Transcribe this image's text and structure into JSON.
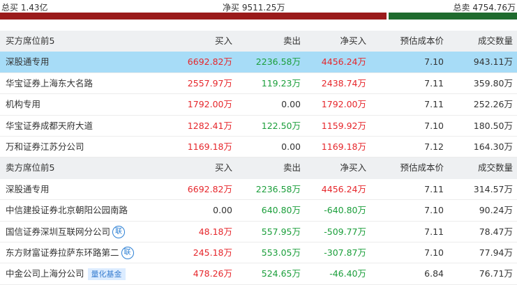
{
  "summary": {
    "total_buy": "总买 1.43亿",
    "net_buy": "净买 9511.25万",
    "total_sell": "总卖 4754.76万",
    "buy_ratio": 0.75,
    "colors": {
      "buy_bar": "#9a1b1b",
      "sell_bar": "#1f6b2e"
    }
  },
  "buy_section": {
    "header": {
      "name": "买方席位前5",
      "buy": "买入",
      "sell": "卖出",
      "net": "净买入",
      "cost": "预估成本价",
      "volume": "成交数量"
    },
    "rows": [
      {
        "name": "深股通专用",
        "buy": "6692.82万",
        "sell": "2236.58万",
        "net": "4456.24万",
        "cost": "7.10",
        "volume": "943.11万",
        "highlight": true
      },
      {
        "name": "华宝证券上海东大名路",
        "buy": "2557.97万",
        "sell": "119.23万",
        "net": "2438.74万",
        "cost": "7.11",
        "volume": "359.80万"
      },
      {
        "name": "机构专用",
        "buy": "1792.00万",
        "sell": "0.00",
        "net": "1792.00万",
        "cost": "7.11",
        "volume": "252.26万"
      },
      {
        "name": "华宝证券成都天府大道",
        "buy": "1282.41万",
        "sell": "122.50万",
        "net": "1159.92万",
        "cost": "7.10",
        "volume": "180.50万"
      },
      {
        "name": "万和证券江苏分公司",
        "buy": "1169.18万",
        "sell": "0.00",
        "net": "1169.18万",
        "cost": "7.12",
        "volume": "164.30万"
      }
    ]
  },
  "sell_section": {
    "header": {
      "name": "卖方席位前5",
      "buy": "买入",
      "sell": "卖出",
      "net": "净买入",
      "cost": "预估成本价",
      "volume": "成交数量"
    },
    "rows": [
      {
        "name": "深股通专用",
        "buy": "6692.82万",
        "sell": "2236.58万",
        "net": "4456.24万",
        "cost": "7.11",
        "volume": "314.57万"
      },
      {
        "name": "中信建投证券北京朝阳公园南路",
        "buy": "0.00",
        "sell": "640.80万",
        "net": "-640.80万",
        "cost": "7.10",
        "volume": "90.24万"
      },
      {
        "name": "国信证券深圳互联网分公司",
        "badge": "联",
        "buy": "48.18万",
        "sell": "557.95万",
        "net": "-509.77万",
        "cost": "7.11",
        "volume": "78.47万"
      },
      {
        "name": "东方财富证券拉萨东环路第二",
        "badge": "联",
        "buy": "245.18万",
        "sell": "553.05万",
        "net": "-307.87万",
        "cost": "7.10",
        "volume": "77.94万"
      },
      {
        "name": "中金公司上海分公司",
        "tag": "量化基金",
        "buy": "478.26万",
        "sell": "524.65万",
        "net": "-46.40万",
        "cost": "6.84",
        "volume": "76.71万"
      }
    ]
  }
}
